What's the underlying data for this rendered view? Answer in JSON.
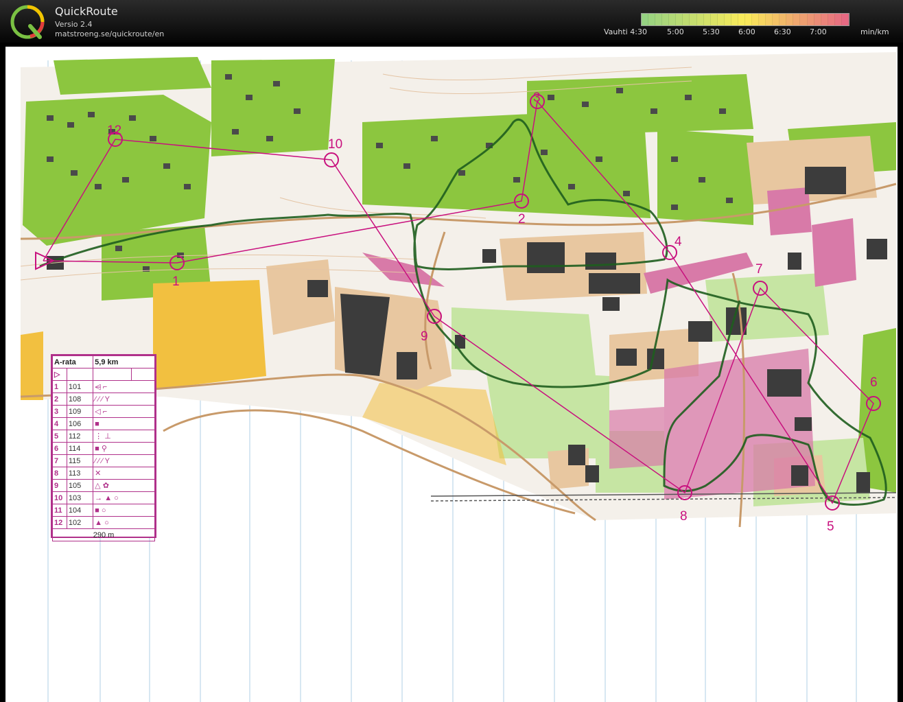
{
  "app": {
    "title": "QuickRoute",
    "version": "Versio 2.4",
    "url": "matstroeng.se/quickroute/en",
    "logo_letter": "Q"
  },
  "pace_scale": {
    "label": "Vauhti",
    "ticks": [
      "4:30",
      "5:00",
      "5:30",
      "6:00",
      "6:30",
      "7:00"
    ],
    "unit": "min/km"
  },
  "colors": {
    "green_area": "#8cc63f",
    "light_green": "#c6e5a3",
    "magenta": "#c8107e",
    "building": "#3c3c3c",
    "paved": "#e8c7a0",
    "route": "#1e5d1e",
    "open_land": "#f2c040"
  },
  "course": {
    "name": "A-rata",
    "length": "5,9 km",
    "scale": "290 m",
    "controls": [
      {
        "num": "1",
        "code": "101",
        "desc": "◁̶  ⌐"
      },
      {
        "num": "2",
        "code": "108",
        "desc": "⁄ ⁄ ⁄ Y"
      },
      {
        "num": "3",
        "code": "109",
        "desc": "◁  ⌐"
      },
      {
        "num": "4",
        "code": "106",
        "desc": "■"
      },
      {
        "num": "5",
        "code": "112",
        "desc": "⋮  ⊥"
      },
      {
        "num": "6",
        "code": "114",
        "desc": "■  ⚲"
      },
      {
        "num": "7",
        "code": "115",
        "desc": "⁄ ⁄ ⁄ Y"
      },
      {
        "num": "8",
        "code": "113",
        "desc": "✕"
      },
      {
        "num": "9",
        "code": "105",
        "desc": "△  ✿"
      },
      {
        "num": "10",
        "code": "103",
        "desc": "→ ▲  ○"
      },
      {
        "num": "11",
        "code": "104",
        "desc": "■  ○"
      },
      {
        "num": "12",
        "code": "102",
        "desc": "▲  ○"
      }
    ],
    "map_labels": [
      "1",
      "2",
      "3",
      "4",
      "5",
      "6",
      "7",
      "8",
      "9",
      "10",
      "12"
    ]
  }
}
